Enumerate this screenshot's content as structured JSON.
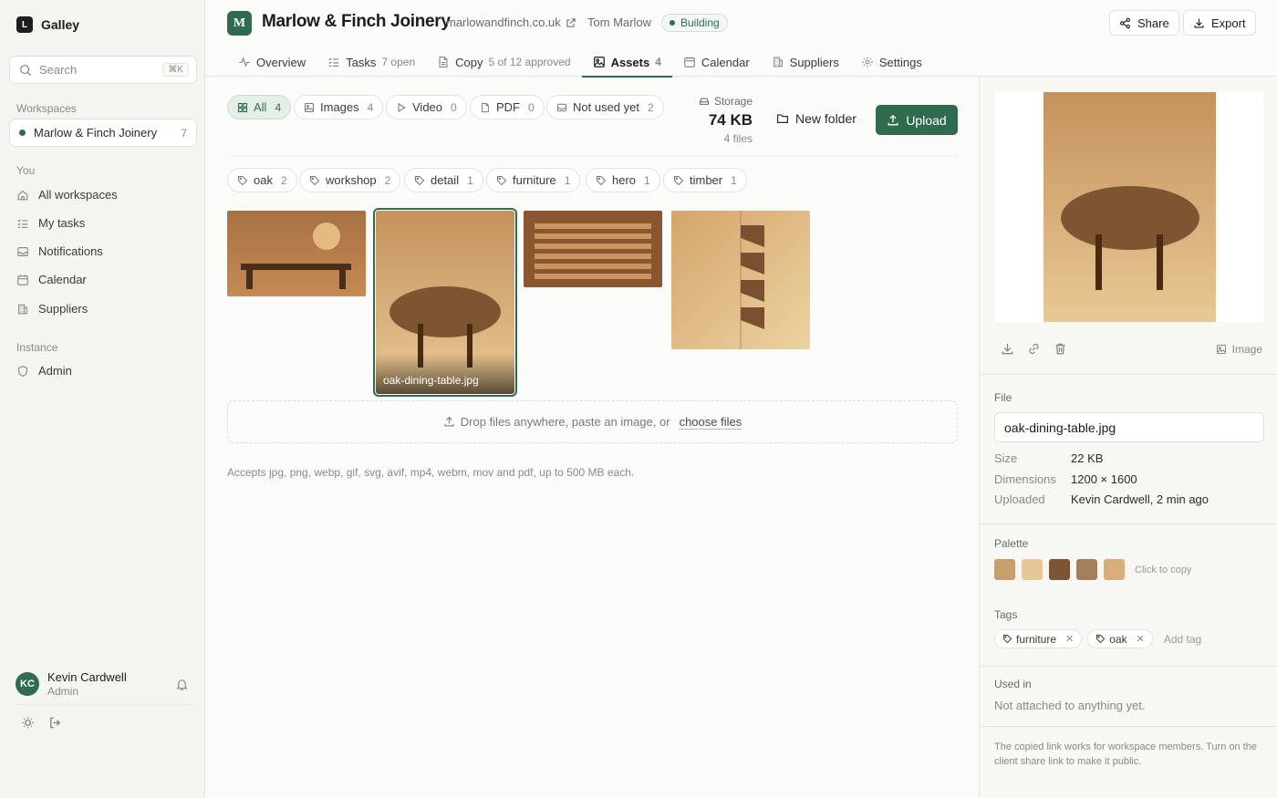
{
  "app": {
    "name": "Galley",
    "logo_letter": "L"
  },
  "search": {
    "placeholder": "Search",
    "shortcut": "⌘K"
  },
  "sidebar": {
    "workspaces_label": "Workspaces",
    "workspace": {
      "name": "Marlow & Finch Joinery",
      "count": "7"
    },
    "you_label": "You",
    "you_items": [
      {
        "label": "All workspaces",
        "icon": "home-icon"
      },
      {
        "label": "My tasks",
        "icon": "tasks-icon"
      },
      {
        "label": "Notifications",
        "icon": "inbox-icon"
      },
      {
        "label": "Calendar",
        "icon": "calendar-icon"
      },
      {
        "label": "Suppliers",
        "icon": "building-icon"
      }
    ],
    "instance_label": "Instance",
    "instance_items": [
      {
        "label": "Admin",
        "icon": "shield-icon"
      }
    ],
    "user": {
      "initials": "KC",
      "name": "Kevin Cardwell",
      "role": "Admin"
    }
  },
  "header": {
    "logo_letter": "M",
    "title": "Marlow & Finch Joinery",
    "url": "marlowandfinch.co.uk",
    "owner": "Tom Marlow",
    "status": "Building",
    "share_label": "Share",
    "export_label": "Export"
  },
  "tabs": [
    {
      "label": "Overview",
      "sub": ""
    },
    {
      "label": "Tasks",
      "sub": "7 open"
    },
    {
      "label": "Copy",
      "sub": "5 of 12 approved"
    },
    {
      "label": "Assets",
      "sub": "4",
      "active": true
    },
    {
      "label": "Calendar",
      "sub": ""
    },
    {
      "label": "Suppliers",
      "sub": ""
    },
    {
      "label": "Settings",
      "sub": ""
    }
  ],
  "filters": [
    {
      "label": "All",
      "count": "4",
      "active": true
    },
    {
      "label": "Images",
      "count": "4"
    },
    {
      "label": "Video",
      "count": "0"
    },
    {
      "label": "PDF",
      "count": "0"
    },
    {
      "label": "Not used yet",
      "count": "2"
    }
  ],
  "storage": {
    "label": "Storage",
    "value": "74 KB",
    "files": "4 files"
  },
  "actions": {
    "new_folder": "New folder",
    "upload": "Upload"
  },
  "tag_filters": [
    {
      "label": "oak",
      "count": "2"
    },
    {
      "label": "workshop",
      "count": "2"
    },
    {
      "label": "detail",
      "count": "1"
    },
    {
      "label": "furniture",
      "count": "1"
    },
    {
      "label": "hero",
      "count": "1"
    },
    {
      "label": "timber",
      "count": "1"
    }
  ],
  "assets": {
    "selected_caption": "oak-dining-table.jpg"
  },
  "dropzone": {
    "text": "Drop files anywhere, paste an image, or",
    "link": "choose files"
  },
  "accepts": "Accepts jpg, png, webp, gif, svg, avif, mp4, webm, mov and pdf, up to 500 MB each.",
  "panel": {
    "type_label": "Image",
    "file_label": "File",
    "file_name": "oak-dining-table.jpg",
    "size_label": "Size",
    "size": "22 KB",
    "dimensions_label": "Dimensions",
    "dimensions": "1200 × 1600",
    "uploaded_label": "Uploaded",
    "uploaded": "Kevin Cardwell, 2 min ago",
    "palette_label": "Palette",
    "palette": [
      "#c79e6e",
      "#e6c795",
      "#7c5533",
      "#a3805b",
      "#d9ad7a"
    ],
    "palette_hint": "Click to copy",
    "tags_label": "Tags",
    "tags": [
      "furniture",
      "oak"
    ],
    "add_tag": "Add tag",
    "used_in_label": "Used in",
    "used_in": "Not attached to anything yet.",
    "note": "The copied link works for workspace members. Turn on the client share link to make it public."
  },
  "colors": {
    "accent": "#2f6b4f",
    "wood_light": "#e6c795",
    "wood_dark": "#5a3a20"
  }
}
